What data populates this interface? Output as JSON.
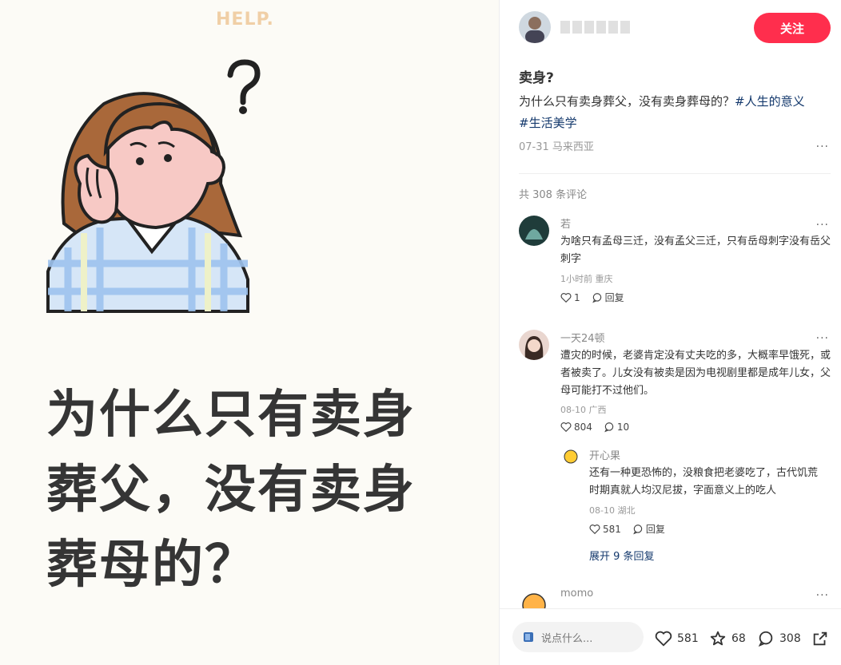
{
  "image": {
    "help_text": "HELP.",
    "headline": [
      "为什么只有卖身",
      "葬父，没有卖身",
      "葬母的？"
    ]
  },
  "author": {
    "follow_label": "关注"
  },
  "post": {
    "title": "卖身?",
    "text": "为什么只有卖身葬父，没有卖身葬母的？",
    "tags": [
      "#人生的意义",
      "#生活美学"
    ],
    "meta": "07-31 马来西亚",
    "more": "···"
  },
  "comments": {
    "total": "共 308 条评论",
    "items": [
      {
        "name": "若",
        "text": "为啥只有孟母三迁，没有孟父三迁，只有岳母刺字没有岳父刺字",
        "meta": "1小时前 重庆",
        "likes": "1",
        "reply": "回复"
      },
      {
        "name": "一天24顿",
        "text": "遭灾的时候，老婆肯定没有丈夫吃的多，大概率早饿死，或者被卖了。儿女没有被卖是因为电视剧里都是成年儿女，父母可能打不过他们。",
        "meta": "08-10 广西",
        "likes": "804",
        "replies": "10"
      },
      {
        "name": "开心果",
        "text": "还有一种更恐怖的，没粮食把老婆吃了，古代饥荒时期真就人均汉尼拔，字面意义上的吃人",
        "meta": "08-10 湖北",
        "likes": "581",
        "reply": "回复"
      },
      {
        "name": "momo"
      }
    ],
    "expand": "展开 9 条回复"
  },
  "bottom": {
    "placeholder": "说点什么...",
    "likes": "581",
    "stars": "68",
    "comments": "308"
  }
}
